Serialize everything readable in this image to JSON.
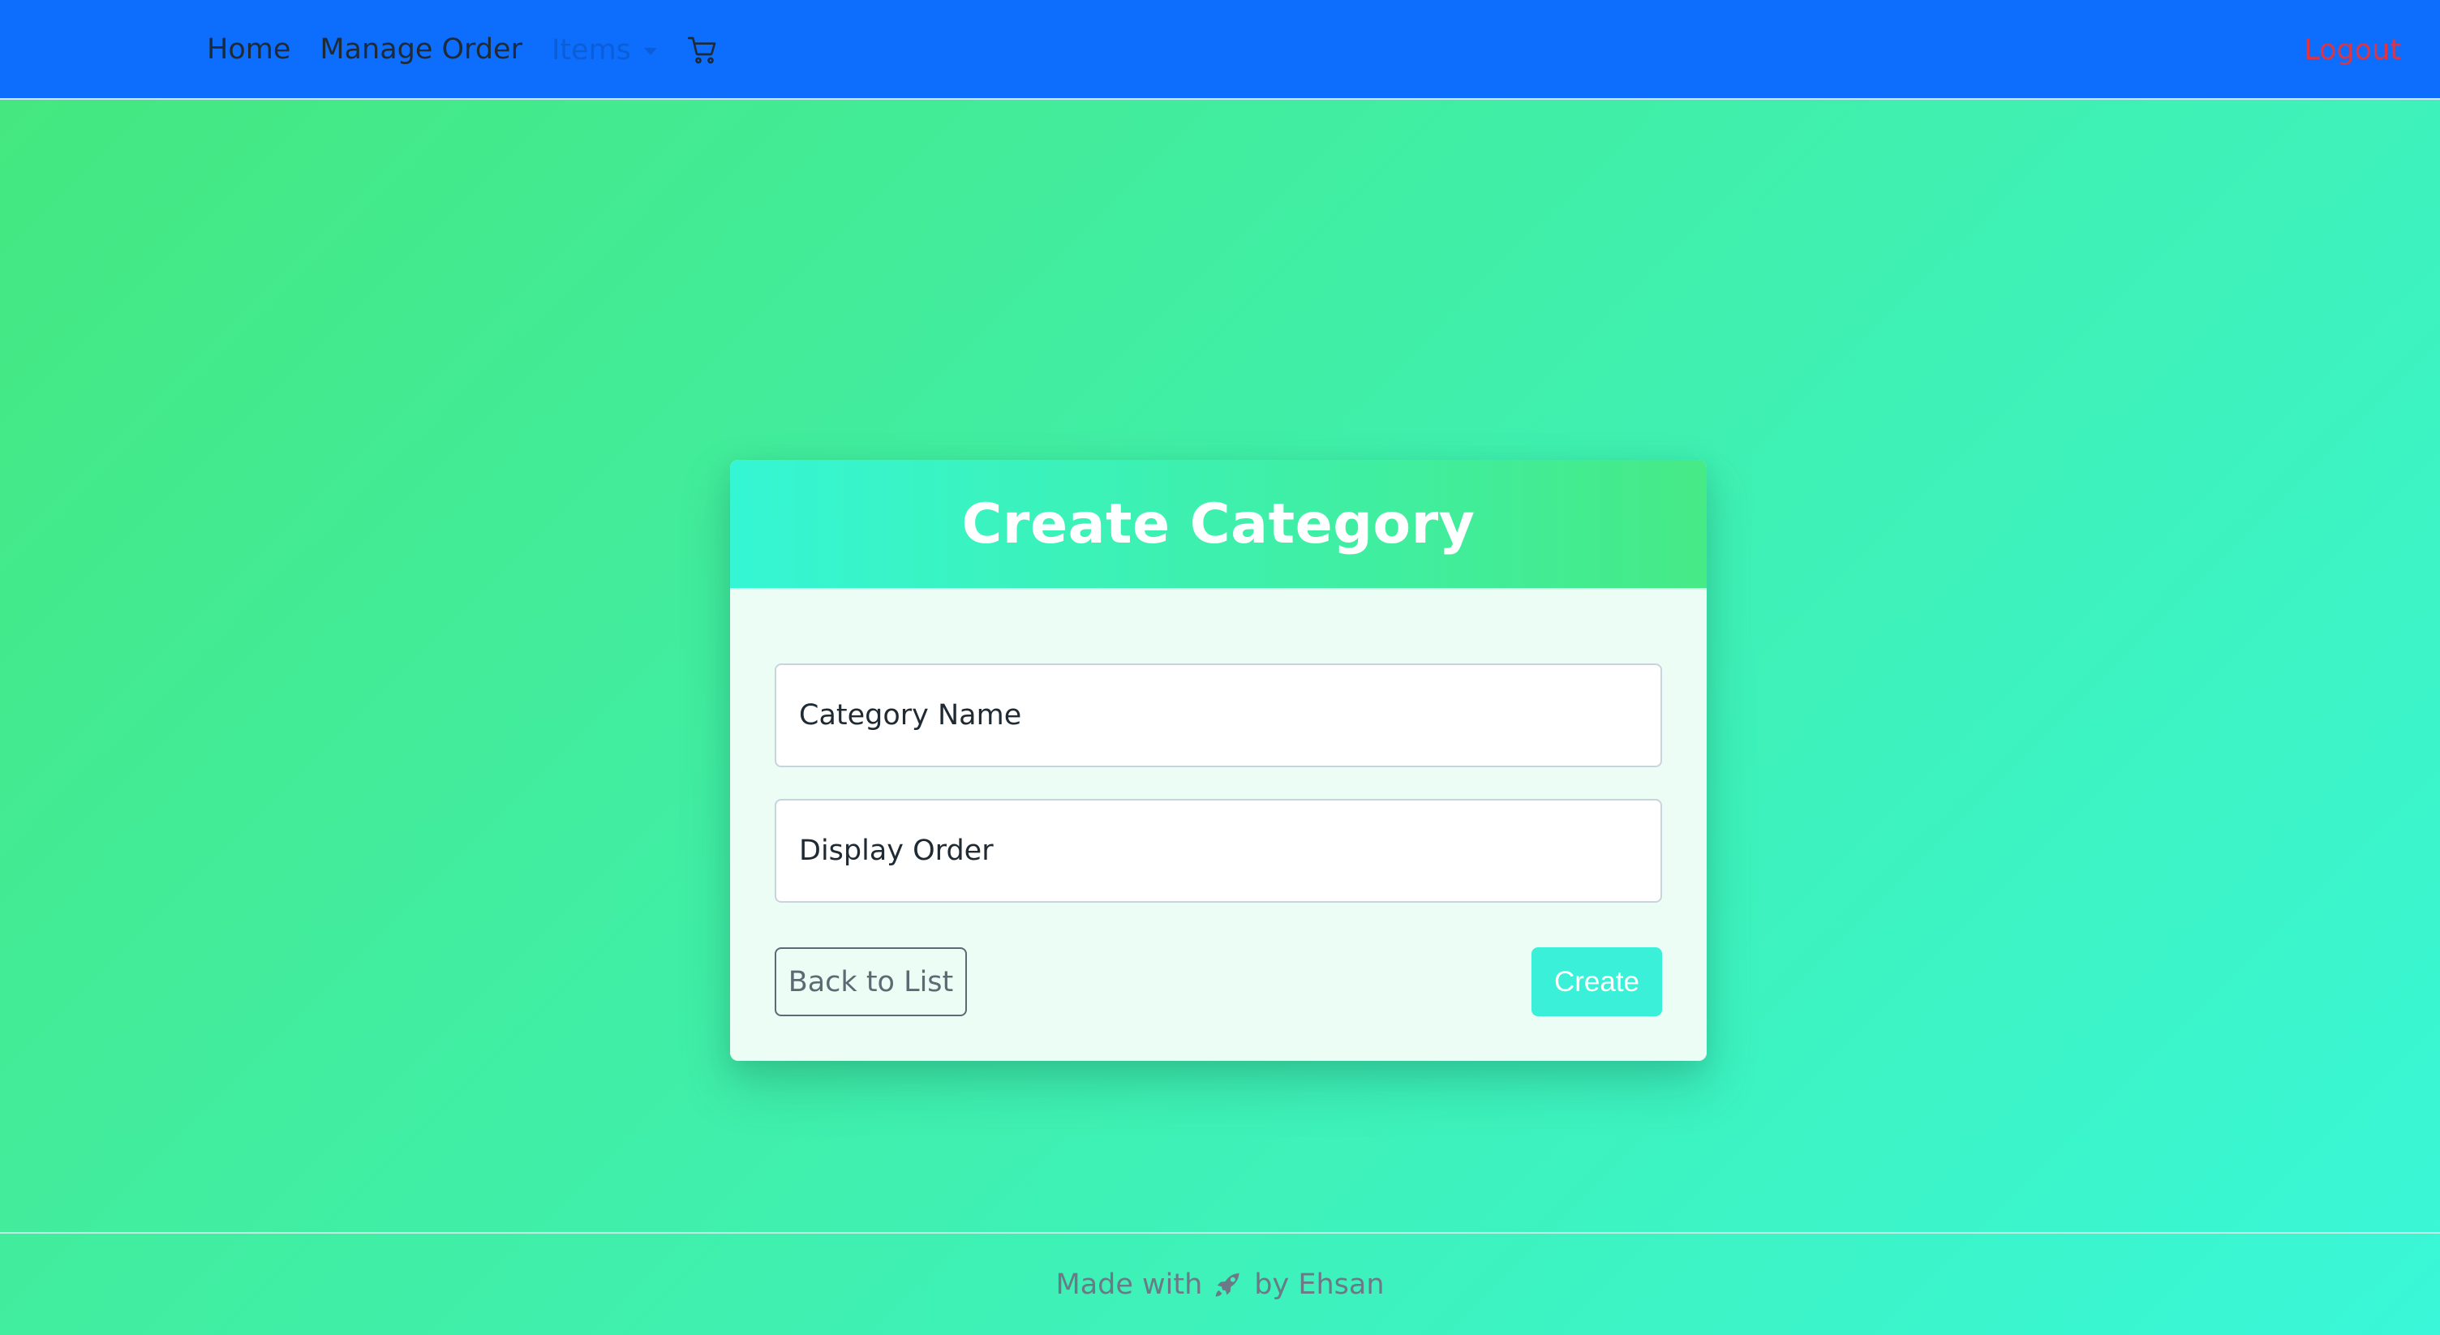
{
  "navbar": {
    "items": [
      {
        "label": "Home"
      },
      {
        "label": "Manage Order"
      }
    ],
    "dropdown": {
      "label": "Items"
    },
    "cart_icon": "cart-icon",
    "logout_label": "Logout",
    "colors": {
      "background": "#0d6efd",
      "logout": "#dc3545",
      "dropdown": "#0b5ed7"
    }
  },
  "card": {
    "title": "Create Category",
    "fields": [
      {
        "placeholder": "Category Name",
        "value": ""
      },
      {
        "placeholder": "Display Order",
        "value": ""
      }
    ],
    "back_label": "Back to List",
    "create_label": "Create",
    "colors": {
      "header_start": "#35f6d4",
      "header_end": "#46ea86",
      "create": "#3af0d8"
    }
  },
  "footer": {
    "text_before": "Made with",
    "icon": "rocket-icon",
    "text_after": "by Ehsan"
  }
}
